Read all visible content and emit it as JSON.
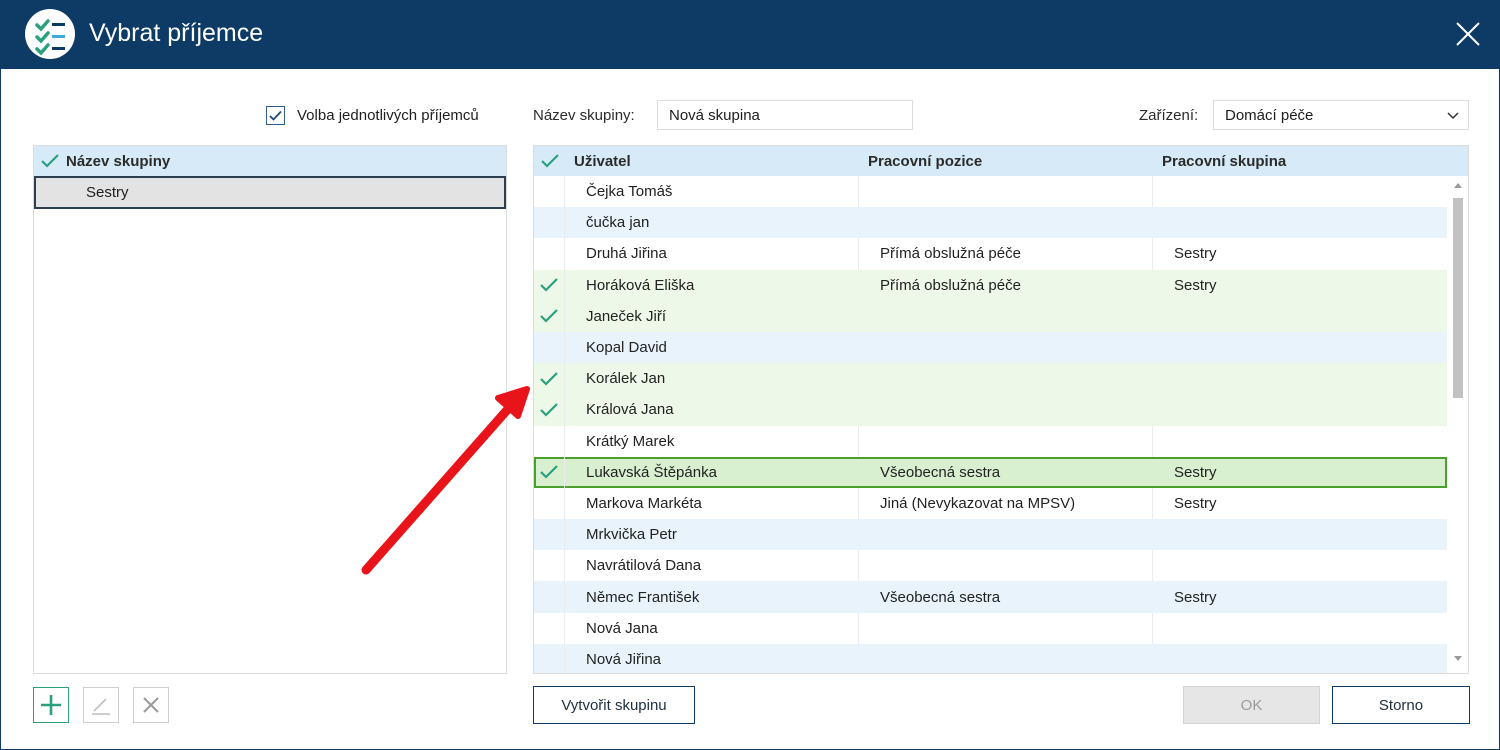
{
  "window": {
    "title": "Vybrat příjemce"
  },
  "options": {
    "individual_label": "Volba jednotlivých příjemců",
    "individual_checked": true
  },
  "left_grid": {
    "header": "Název skupiny",
    "rows": [
      "Sestry"
    ]
  },
  "form": {
    "group_name_label": "Název skupiny:",
    "group_name_value": "Nová skupina",
    "facility_label": "Zařízení:",
    "facility_value": "Domácí péče"
  },
  "main_grid": {
    "headers": {
      "user": "Uživatel",
      "position": "Pracovní pozice",
      "group": "Pracovní skupina"
    },
    "rows": [
      {
        "user": "Čejka Tomáš",
        "position": "",
        "group": "",
        "checked": false
      },
      {
        "user": "čučka jan",
        "position": "",
        "group": "",
        "checked": false
      },
      {
        "user": "Druhá Jiřina",
        "position": "Přímá obslužná péče",
        "group": "Sestry",
        "checked": false
      },
      {
        "user": "Horáková Eliška",
        "position": "Přímá obslužná péče",
        "group": "Sestry",
        "checked": true
      },
      {
        "user": "Janeček Jiří",
        "position": "",
        "group": "",
        "checked": true
      },
      {
        "user": "Kopal David",
        "position": "",
        "group": "",
        "checked": false
      },
      {
        "user": "Korálek Jan",
        "position": "",
        "group": "",
        "checked": true
      },
      {
        "user": "Králová Jana",
        "position": "",
        "group": "",
        "checked": true
      },
      {
        "user": "Krátký Marek",
        "position": "",
        "group": "",
        "checked": false
      },
      {
        "user": "Lukavská Štěpánka",
        "position": "Všeobecná sestra",
        "group": "Sestry",
        "checked": true,
        "selected": true
      },
      {
        "user": "Markova Markéta",
        "position": "Jiná (Nevykazovat na MPSV)",
        "group": "Sestry",
        "checked": false
      },
      {
        "user": "Mrkvička Petr",
        "position": "",
        "group": "",
        "checked": false
      },
      {
        "user": "Navrátilová Dana",
        "position": "",
        "group": "",
        "checked": false
      },
      {
        "user": "Němec František",
        "position": "Všeobecná sestra",
        "group": "Sestry",
        "checked": false
      },
      {
        "user": "Nová Jana",
        "position": "",
        "group": "",
        "checked": false
      },
      {
        "user": "Nová Jiřina",
        "position": "",
        "group": "",
        "checked": false
      }
    ]
  },
  "buttons": {
    "create_group": "Vytvořit skupinu",
    "ok": "OK",
    "cancel": "Storno"
  },
  "colors": {
    "titlebar": "#0d3b66",
    "accent": "#2aa07f",
    "header_bg": "#d6ebf7",
    "annotation_arrow": "#e8141a"
  },
  "icons": [
    "app-checklist-icon",
    "close-icon",
    "checkmark-icon",
    "chevron-down-icon",
    "plus-icon",
    "pencil-icon",
    "x-icon"
  ]
}
